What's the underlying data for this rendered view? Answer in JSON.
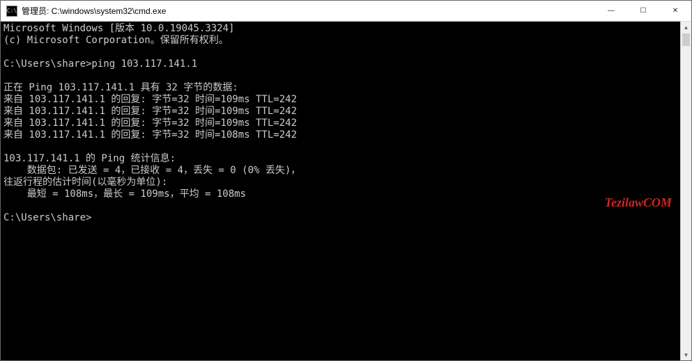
{
  "titlebar": {
    "icon_glyph": "C:\\",
    "title": "管理员: C:\\windows\\system32\\cmd.exe",
    "minimize": "—",
    "maximize": "☐",
    "close": "✕"
  },
  "console": {
    "header1": "Microsoft Windows [版本 10.0.19045.3324]",
    "header2": "(c) Microsoft Corporation。保留所有权利。",
    "blank": "",
    "prompt1": "C:\\Users\\share>ping 103.117.141.1",
    "ping_header": "正在 Ping 103.117.141.1 具有 32 字节的数据:",
    "reply1": "来自 103.117.141.1 的回复: 字节=32 时间=109ms TTL=242",
    "reply2": "来自 103.117.141.1 的回复: 字节=32 时间=109ms TTL=242",
    "reply3": "来自 103.117.141.1 的回复: 字节=32 时间=109ms TTL=242",
    "reply4": "来自 103.117.141.1 的回复: 字节=32 时间=108ms TTL=242",
    "stats_header": "103.117.141.1 的 Ping 统计信息:",
    "packets": "    数据包: 已发送 = 4，已接收 = 4，丢失 = 0 (0% 丢失)，",
    "rtt_header": "往返行程的估计时间(以毫秒为单位):",
    "rtt_values": "    最短 = 108ms，最长 = 109ms，平均 = 108ms",
    "prompt2": "C:\\Users\\share>"
  },
  "watermark": "TezilawCOM",
  "scrollbar": {
    "up": "▲",
    "down": "▼"
  }
}
